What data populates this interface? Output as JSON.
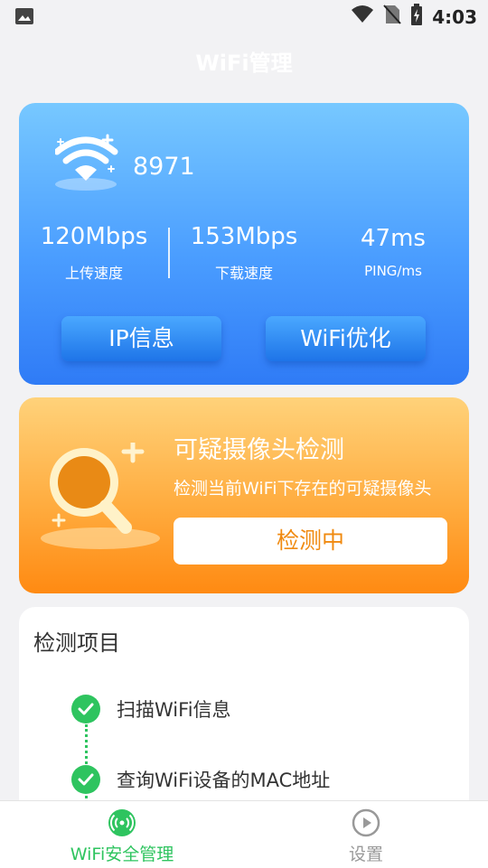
{
  "status_bar": {
    "time": "4:03"
  },
  "header": {
    "title": "WiFi管理"
  },
  "wifi_card": {
    "network_name": "8971",
    "upload": {
      "value": "120Mbps",
      "label": "上传速度"
    },
    "download": {
      "value": "153Mbps",
      "label": "下载速度"
    },
    "ping": {
      "value": "47ms",
      "label": "PING/ms"
    },
    "ip_button": "IP信息",
    "optimize_button": "WiFi优化"
  },
  "camera_card": {
    "title": "可疑摄像头检测",
    "description": "检测当前WiFi下存在的可疑摄像头",
    "button": "检测中"
  },
  "check_list": {
    "title": "检测项目",
    "items": [
      {
        "label": "扫描WiFi信息",
        "status": "done"
      },
      {
        "label": "查询WiFi设备的MAC地址",
        "status": "done"
      }
    ]
  },
  "bottom_nav": {
    "items": [
      {
        "label": "WiFi安全管理",
        "icon": "wifi-signal-icon",
        "active": true
      },
      {
        "label": "设置",
        "icon": "play-circle-icon",
        "active": false
      }
    ]
  },
  "colors": {
    "active_green": "#2ec45f",
    "blue_card": "#4a9dff",
    "orange_card": "#ff9a26",
    "inactive_gray": "#999999"
  }
}
